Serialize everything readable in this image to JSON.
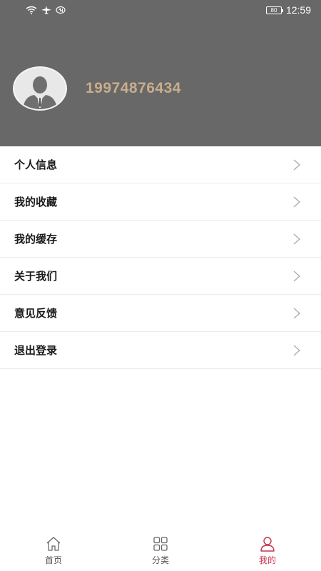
{
  "status_bar": {
    "icons": [
      "wifi-icon",
      "airplane-icon",
      "data-icon"
    ],
    "battery": "80",
    "time": "12:59"
  },
  "profile": {
    "avatar_icon": "user-avatar-icon",
    "phone": "19974876434"
  },
  "menu": {
    "items": [
      {
        "label": "个人信息",
        "icon": "chevron-right-icon"
      },
      {
        "label": "我的收藏",
        "icon": "chevron-right-icon"
      },
      {
        "label": "我的缓存",
        "icon": "chevron-right-icon"
      },
      {
        "label": "关于我们",
        "icon": "chevron-right-icon"
      },
      {
        "label": "意见反馈",
        "icon": "chevron-right-icon"
      },
      {
        "label": "退出登录",
        "icon": "chevron-right-icon"
      }
    ]
  },
  "tabbar": {
    "tabs": [
      {
        "label": "首页",
        "icon": "home-icon",
        "active": false
      },
      {
        "label": "分类",
        "icon": "grid-icon",
        "active": false
      },
      {
        "label": "我的",
        "icon": "person-icon",
        "active": true
      }
    ]
  },
  "colors": {
    "header_bg": "#686868",
    "phone_text": "#c9ad8c",
    "active_tab": "#c8324a"
  }
}
